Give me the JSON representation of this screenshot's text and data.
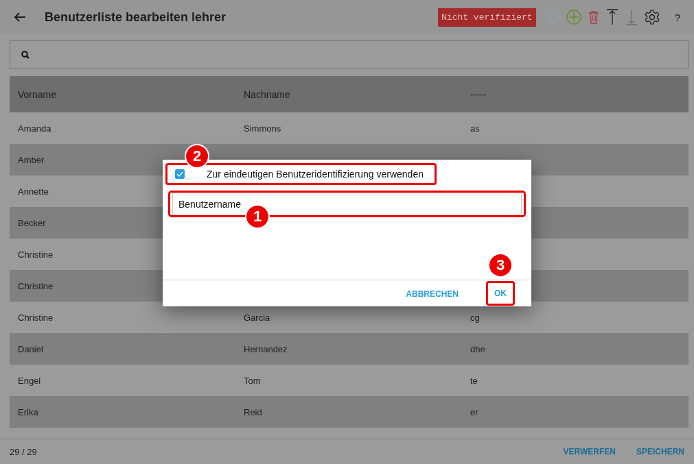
{
  "header": {
    "title": "Benutzerliste bearbeiten lehrer",
    "status_badge": "Nicht verifiziert",
    "help": "?"
  },
  "table": {
    "columns": [
      "Vorname",
      "Nachname",
      "-----"
    ],
    "rows": [
      {
        "cells": [
          "Amanda",
          "Simmons",
          "as"
        ]
      },
      {
        "cells": [
          "Amber"
        ]
      },
      {
        "cells": [
          "Annette"
        ]
      },
      {
        "cells": [
          "Becker"
        ]
      },
      {
        "cells": [
          "Christine"
        ]
      },
      {
        "cells": [
          "Christine"
        ]
      },
      {
        "cells": [
          "Christine",
          "Garcia",
          "cg"
        ]
      },
      {
        "cells": [
          "Daniel",
          "Hernandez",
          "dhe"
        ]
      },
      {
        "cells": [
          "Engel",
          "Tom",
          "te"
        ]
      },
      {
        "cells": [
          "Erika",
          "Reid",
          "er"
        ]
      }
    ]
  },
  "footer": {
    "count": "29 / 29",
    "buttons": [
      "VERWERFEN",
      "SPEICHERN"
    ]
  },
  "dialog": {
    "checkbox": {
      "label": "Zur eindeutigen Benutzeridentifizierung verwenden",
      "checked": true,
      "callout": "2"
    },
    "field": {
      "value": "Benutzername",
      "callout": "1"
    },
    "buttons": [
      {
        "label": "ABBRECHEN"
      },
      {
        "label": "OK",
        "callout": "3"
      }
    ]
  }
}
